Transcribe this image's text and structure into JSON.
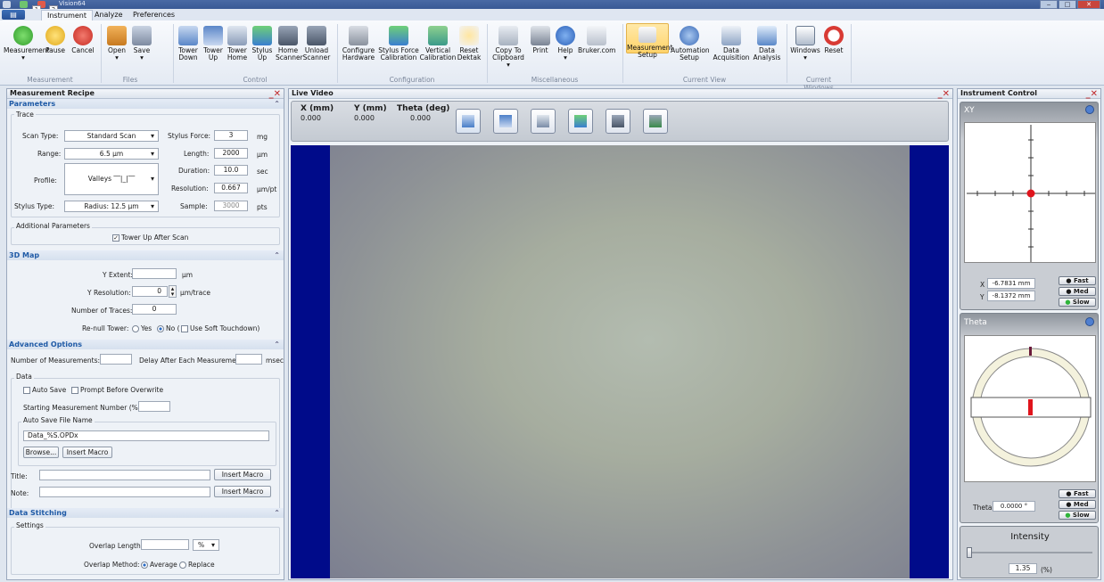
{
  "window": {
    "title": "Vision64",
    "qa1": "1",
    "qa2": "2"
  },
  "tabs": [
    "Instrument",
    "Analyze",
    "Preferences"
  ],
  "ribbon": {
    "groups": [
      {
        "name": "Measurement",
        "items": [
          "Measurement",
          "Pause",
          "Cancel"
        ]
      },
      {
        "name": "Files",
        "items": [
          "Open",
          "Save"
        ]
      },
      {
        "name": "Control",
        "items": [
          "Tower Down",
          "Tower Up",
          "Tower Home",
          "Stylus Up",
          "Home Scanner",
          "Unload Scanner"
        ]
      },
      {
        "name": "Configuration",
        "items": [
          "Configure Hardware",
          "Stylus Force Calibration",
          "Vertical Calibration",
          "Reset Dektak"
        ]
      },
      {
        "name": "Miscellaneous",
        "items": [
          "Copy To Clipboard ▾",
          "Print",
          "Help",
          "Bruker.com"
        ]
      },
      {
        "name": "Current View",
        "items": [
          "Measurement Setup",
          "Automation Setup",
          "Data Acquisition",
          "Data Analysis"
        ]
      },
      {
        "name": "Current Windows",
        "items": [
          "Windows",
          "Reset"
        ]
      }
    ]
  },
  "recipe": {
    "title": "Measurement Recipe",
    "parameters": "Parameters",
    "trace": "Trace",
    "scan_type_label": "Scan Type:",
    "scan_type": "Standard Scan",
    "range_label": "Range:",
    "range": "6.5 µm",
    "profile_label": "Profile:",
    "profile": "Valleys ‾‾|_|‾‾",
    "stylus_type_label": "Stylus Type:",
    "stylus_type": "Radius: 12.5 µm",
    "stylus_force_label": "Stylus Force:",
    "stylus_force": "3",
    "stylus_force_unit": "mg",
    "length_label": "Length:",
    "length": "2000",
    "length_unit": "µm",
    "duration_label": "Duration:",
    "duration": "10.0",
    "duration_unit": "sec",
    "resolution_label": "Resolution:",
    "resolution": "0.667",
    "resolution_unit": "µm/pt",
    "sample_label": "Sample:",
    "sample": "3000",
    "sample_unit": "pts",
    "additional": "Additional Parameters",
    "tower_up": "Tower Up After Scan",
    "map3d": "3D Map",
    "y_extent_label": "Y Extent:",
    "y_extent_unit": "µm",
    "y_res_label": "Y Resolution:",
    "y_res": "0",
    "y_res_unit": "µm/trace",
    "traces_label": "Number of Traces:",
    "traces": "0",
    "renull_label": "Re-null Tower:",
    "renull_yes": "Yes",
    "renull_no": "No (",
    "soft_touchdown": "Use Soft Touchdown)",
    "advanced": "Advanced Options",
    "num_meas_label": "Number of Measurements:",
    "delay_label": "Delay After Each Measurement:",
    "delay_unit": "msec",
    "data": "Data",
    "auto_save": "Auto Save",
    "prompt_overwrite": "Prompt Before Overwrite",
    "start_num_label": "Starting Measurement Number (%S):",
    "auto_save_name": "Auto Save File Name",
    "file_name": "Data_%S.OPDx",
    "browse": "Browse...",
    "insert_macro": "Insert Macro",
    "title_label": "Title:",
    "note_label": "Note:",
    "stitching": "Data Stitching",
    "settings": "Settings",
    "overlap_len_label": "Overlap Length:",
    "overlap_unit": "%",
    "overlap_method_label": "Overlap Method:",
    "average": "Average",
    "replace": "Replace"
  },
  "video": {
    "title": "Live Video",
    "x_label": "X (mm)",
    "x": "0.000",
    "y_label": "Y (mm)",
    "y": "0.000",
    "theta_label": "Theta (deg)",
    "theta": "0.000"
  },
  "instrument": {
    "title": "Instrument Control",
    "xy_title": "XY",
    "x_label": "X",
    "x_value": "-6.7831 mm",
    "y_label": "Y",
    "y_value": "-8.1372 mm",
    "fast": "Fast",
    "med": "Med",
    "slow": "Slow",
    "theta_title": "Theta",
    "theta_label": "Theta",
    "theta_value": "0.0000 °",
    "intensity_title": "Intensity",
    "intensity_value": "1.35",
    "intensity_unit": "(%)",
    "intensity_level_pct": 1.35
  },
  "colors": {
    "accent": "#1f5aa6",
    "video_border": "#000b8a",
    "close": "#c0282a"
  }
}
